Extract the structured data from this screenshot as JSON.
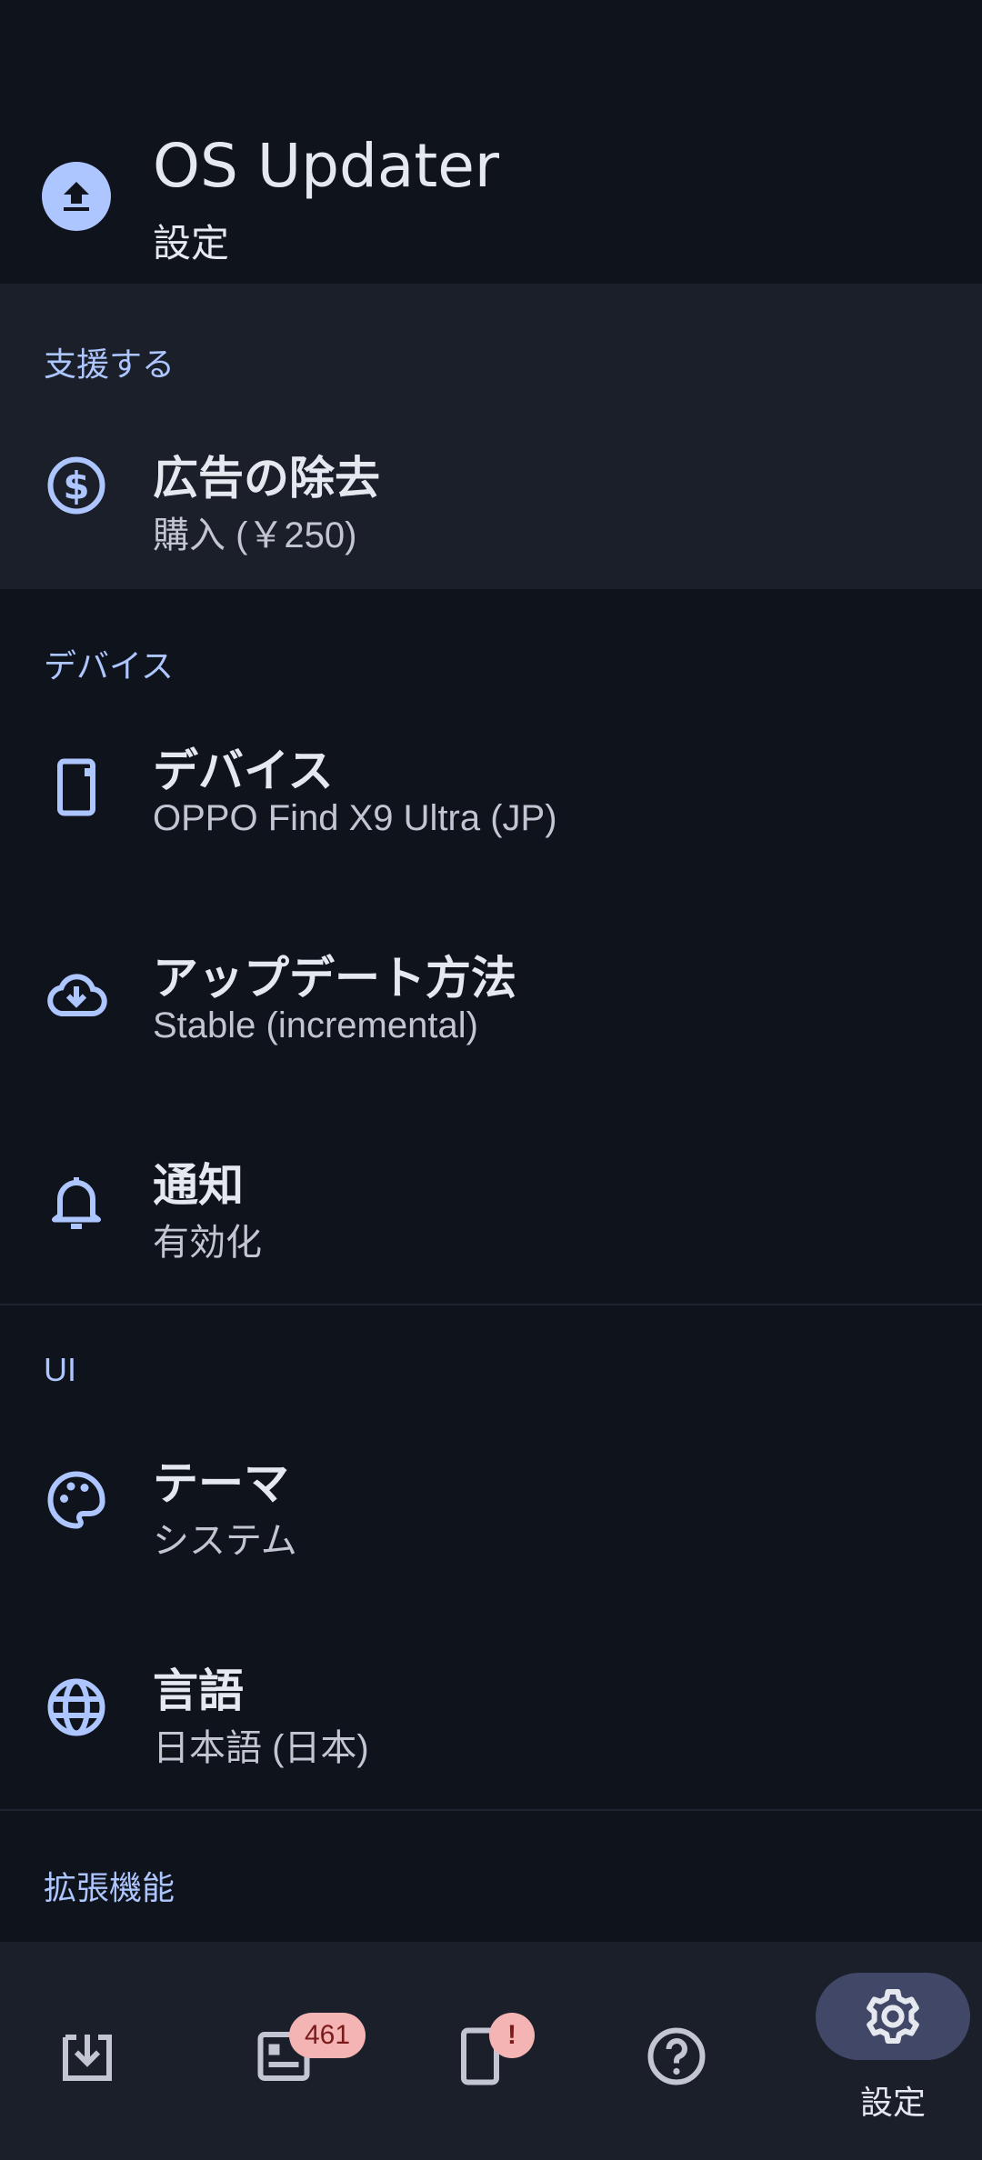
{
  "header": {
    "title": "OS Updater",
    "subtitle": "設定"
  },
  "sections": {
    "support": {
      "label": "支援する",
      "items": [
        {
          "title": "広告の除去",
          "subtitle": "購入 (￥250)",
          "icon": "dollar-icon"
        }
      ]
    },
    "device": {
      "label": "デバイス",
      "items": [
        {
          "title": "デバイス",
          "subtitle": "OPPO Find X9 Ultra (JP)",
          "icon": "phone-icon"
        },
        {
          "title": "アップデート方法",
          "subtitle": "Stable (incremental)",
          "icon": "cloud-download-icon"
        },
        {
          "title": "通知",
          "subtitle": "有効化",
          "icon": "bell-icon"
        }
      ]
    },
    "ui": {
      "label": "UI",
      "items": [
        {
          "title": "テーマ",
          "subtitle": "システム",
          "icon": "palette-icon"
        },
        {
          "title": "言語",
          "subtitle": "日本語 (日本)",
          "icon": "globe-icon"
        }
      ]
    },
    "extensions": {
      "label": "拡張機能"
    }
  },
  "bottom_nav": {
    "items": [
      {
        "icon": "download-icon"
      },
      {
        "icon": "news-icon",
        "badge": "461"
      },
      {
        "icon": "device-icon",
        "badge": "!"
      },
      {
        "icon": "help-icon"
      },
      {
        "icon": "settings-icon",
        "label": "設定",
        "active": true
      }
    ]
  },
  "colors": {
    "background": "#0f131c",
    "surface": "#1b1f2a",
    "accent": "#aec6ff",
    "badge": "#f5b4b4",
    "active_pill": "#414766"
  }
}
